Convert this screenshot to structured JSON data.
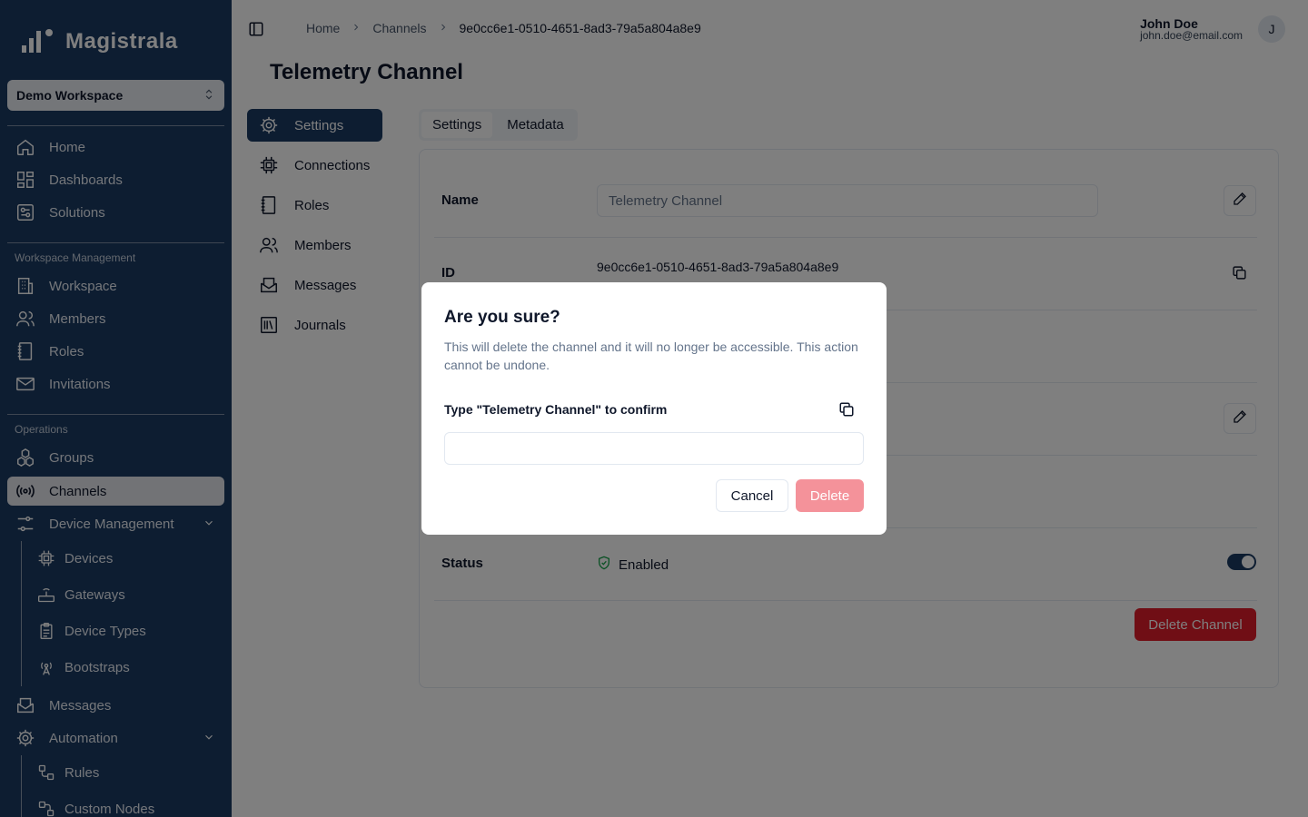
{
  "brand": {
    "name": "Magistrala"
  },
  "workspace": {
    "selected": "Demo Workspace"
  },
  "sidebar": {
    "main": [
      {
        "label": "Home",
        "icon": "home-icon"
      },
      {
        "label": "Dashboards",
        "icon": "dashboard-icon"
      },
      {
        "label": "Solutions",
        "icon": "solutions-icon"
      }
    ],
    "workspace_section": "Workspace Management",
    "workspace_items": [
      {
        "label": "Workspace",
        "icon": "building-icon"
      },
      {
        "label": "Members",
        "icon": "users-icon"
      },
      {
        "label": "Roles",
        "icon": "roles-icon"
      },
      {
        "label": "Invitations",
        "icon": "mail-icon"
      }
    ],
    "operations_section": "Operations",
    "operations_items": [
      {
        "label": "Groups",
        "icon": "groups-icon"
      },
      {
        "label": "Channels",
        "icon": "radio-icon",
        "active": true
      },
      {
        "label": "Device Management",
        "icon": "sliders-icon",
        "expandable": true
      }
    ],
    "device_items": [
      {
        "label": "Devices",
        "icon": "chip-icon"
      },
      {
        "label": "Gateways",
        "icon": "router-icon"
      },
      {
        "label": "Device Types",
        "icon": "clipboard-icon"
      },
      {
        "label": "Bootstraps",
        "icon": "antenna-icon"
      }
    ],
    "more_items": [
      {
        "label": "Messages",
        "icon": "mail-open-icon"
      },
      {
        "label": "Automation",
        "icon": "gear-icon",
        "expandable": true
      }
    ],
    "automation_items": [
      {
        "label": "Rules",
        "icon": "workflow-icon"
      },
      {
        "label": "Custom Nodes",
        "icon": "nodes-icon"
      }
    ]
  },
  "header": {
    "breadcrumb": [
      "Home",
      "Channels",
      "9e0cc6e1-0510-4651-8ad3-79a5a804a8e9"
    ],
    "user_name": "John Doe",
    "user_email": "john.doe@email.com",
    "avatar_initial": "J"
  },
  "page": {
    "title": "Telemetry Channel",
    "inner_nav": [
      {
        "label": "Settings",
        "icon": "gear-icon",
        "active": true
      },
      {
        "label": "Connections",
        "icon": "chip-icon"
      },
      {
        "label": "Roles",
        "icon": "roles-icon"
      },
      {
        "label": "Members",
        "icon": "users-icon"
      },
      {
        "label": "Messages",
        "icon": "mail-open-icon"
      },
      {
        "label": "Journals",
        "icon": "library-icon"
      }
    ],
    "tabs": [
      {
        "label": "Settings",
        "active": true
      },
      {
        "label": "Metadata"
      }
    ],
    "fields": {
      "name_label": "Name",
      "name_value": "Telemetry Channel",
      "id_label": "ID",
      "id_value": "9e0cc6e1-0510-4651-8ad3-79a5a804a8e9",
      "status_label": "Status",
      "status_value": "Enabled"
    },
    "delete_button": "Delete Channel"
  },
  "modal": {
    "title": "Are you sure?",
    "description": "This will delete the channel and it will no longer be accessible. This action cannot be undone.",
    "confirm_label": "Type \"Telemetry Channel\" to confirm",
    "input_value": "",
    "cancel": "Cancel",
    "delete": "Delete"
  },
  "colors": {
    "sidebar_bg": "#1a3a63",
    "danger": "#e11d2a",
    "danger_disabled": "#f4929a"
  }
}
